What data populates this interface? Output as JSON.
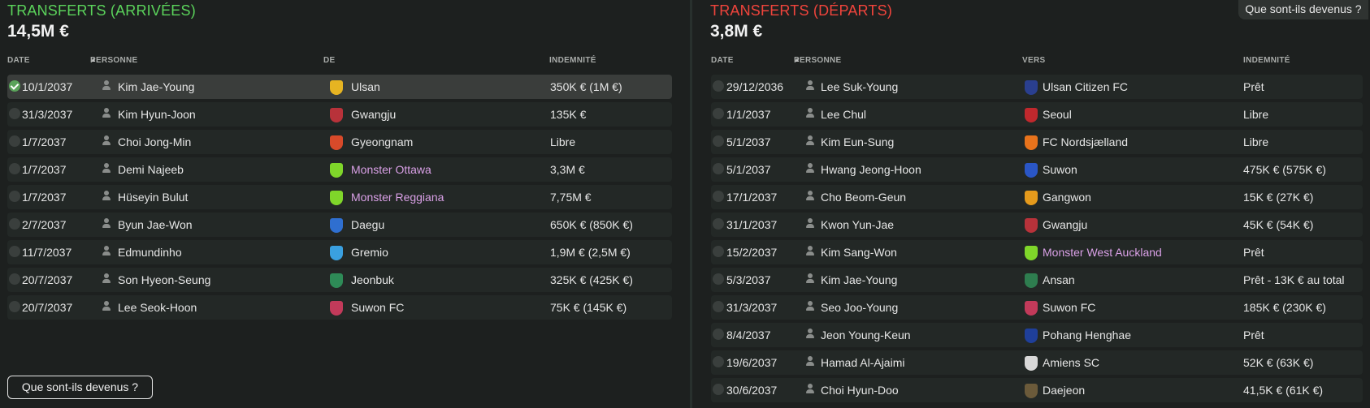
{
  "arrivals": {
    "title": "TRANSFERTS (ARRIVÉES)",
    "total": "14,5M €",
    "columns": {
      "date": "DATE",
      "person": "PERSONNE",
      "club": "DE",
      "fee": "INDEMNITÉ"
    },
    "rows": [
      {
        "date": "10/1/2037",
        "person": "Kim Jae-Young",
        "club": "Ulsan",
        "fee": "350K € (1M €)",
        "checked": true,
        "crest_color": "#e6b422"
      },
      {
        "date": "31/3/2037",
        "person": "Kim Hyun-Joon",
        "club": "Gwangju",
        "fee": "135K €",
        "checked": false,
        "crest_color": "#b8323a"
      },
      {
        "date": "1/7/2037",
        "person": "Choi Jong-Min",
        "club": "Gyeongnam",
        "fee": "Libre",
        "checked": false,
        "crest_color": "#d84a2a"
      },
      {
        "date": "1/7/2037",
        "person": "Demi Najeeb",
        "club": "Monster Ottawa",
        "fee": "3,3M €",
        "checked": false,
        "crest_color": "#7fd62a",
        "club_purple": true
      },
      {
        "date": "1/7/2037",
        "person": "Hüseyin Bulut",
        "club": "Monster Reggiana",
        "fee": "7,75M €",
        "checked": false,
        "crest_color": "#7fd62a",
        "club_purple": true
      },
      {
        "date": "2/7/2037",
        "person": "Byun Jae-Won",
        "club": "Daegu",
        "fee": "650K € (850K €)",
        "checked": false,
        "crest_color": "#2f6fd0"
      },
      {
        "date": "11/7/2037",
        "person": "Edmundinho",
        "club": "Gremio",
        "fee": "1,9M € (2,5M €)",
        "checked": false,
        "crest_color": "#3aa0e0"
      },
      {
        "date": "20/7/2037",
        "person": "Son Hyeon-Seung",
        "club": "Jeonbuk",
        "fee": "325K € (425K €)",
        "checked": false,
        "crest_color": "#2e8b57"
      },
      {
        "date": "20/7/2037",
        "person": "Lee Seok-Hoon",
        "club": "Suwon FC",
        "fee": "75K € (145K €)",
        "checked": false,
        "crest_color": "#c23a5a"
      }
    ],
    "button_label": "Que sont-ils devenus ?"
  },
  "departures": {
    "title": "TRANSFERTS (DÉPARTS)",
    "total": "3,8M €",
    "columns": {
      "date": "DATE",
      "person": "PERSONNE",
      "club": "VERS",
      "fee": "INDEMNITÉ"
    },
    "rows": [
      {
        "date": "29/12/2036",
        "person": "Lee Suk-Young",
        "club": "Ulsan Citizen FC",
        "fee": "Prêt",
        "crest_color": "#2a3f8f"
      },
      {
        "date": "1/1/2037",
        "person": "Lee Chul",
        "club": "Seoul",
        "fee": "Libre",
        "crest_color": "#c0282d"
      },
      {
        "date": "5/1/2037",
        "person": "Kim Eun-Sung",
        "club": "FC Nordsjælland",
        "fee": "Libre",
        "crest_color": "#e8731c"
      },
      {
        "date": "5/1/2037",
        "person": "Hwang Jeong-Hoon",
        "club": "Suwon",
        "fee": "475K € (575K €)",
        "crest_color": "#2a56c6"
      },
      {
        "date": "17/1/2037",
        "person": "Cho Beom-Geun",
        "club": "Gangwon",
        "fee": "15K € (27K €)",
        "crest_color": "#e59a1c"
      },
      {
        "date": "31/1/2037",
        "person": "Kwon Yun-Jae",
        "club": "Gwangju",
        "fee": "45K € (54K €)",
        "crest_color": "#b8323a"
      },
      {
        "date": "15/2/2037",
        "person": "Kim Sang-Won",
        "club": "Monster West Auckland",
        "fee": "Prêt",
        "crest_color": "#7fd62a",
        "club_purple": true
      },
      {
        "date": "5/3/2037",
        "person": "Kim Jae-Young",
        "club": "Ansan",
        "fee": "Prêt - 13K € au total",
        "crest_color": "#2e7d4f"
      },
      {
        "date": "31/3/2037",
        "person": "Seo Joo-Young",
        "club": "Suwon FC",
        "fee": "185K € (230K €)",
        "crest_color": "#c23a5a"
      },
      {
        "date": "8/4/2037",
        "person": "Jeon Young-Keun",
        "club": "Pohang Henghae",
        "fee": "Prêt",
        "crest_color": "#1f3f9a"
      },
      {
        "date": "19/6/2037",
        "person": "Hamad Al-Ajaimi",
        "club": "Amiens SC",
        "fee": "52K € (63K €)",
        "crest_color": "#d8d8d8"
      },
      {
        "date": "30/6/2037",
        "person": "Choi Hyun-Doo",
        "club": "Daejeon",
        "fee": "41,5K € (61K €)",
        "crest_color": "#6b5a3a"
      }
    ],
    "button_label": "Que sont-ils devenus ?"
  }
}
